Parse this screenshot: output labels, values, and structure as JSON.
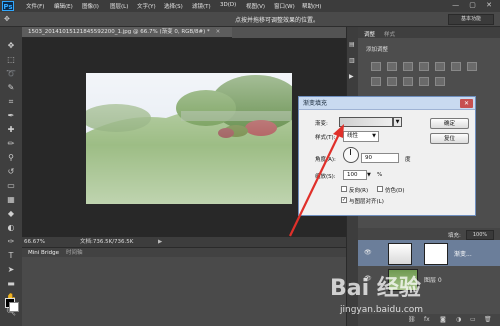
{
  "app": {
    "logo": "Ps"
  },
  "menu": [
    "文件(F)",
    "编辑(E)",
    "图像(I)",
    "图层(L)",
    "文字(Y)",
    "选择(S)",
    "滤镜(T)",
    "3D(D)",
    "视图(V)",
    "窗口(W)",
    "帮助(H)"
  ],
  "window_controls": "— ▢ ✕",
  "options_bar": {
    "hint": "点按并拖移可调整效果的位置。",
    "workspace": "基本功能"
  },
  "document": {
    "tab_title": "1503_20141015121845592200_1.jpg @ 66.7% (渐变 0, RGB/8#) *",
    "zoom": "66.67%",
    "doc_size": "文档:736.5K/736.5K"
  },
  "bottom_panel": {
    "tab1": "Mini Bridge",
    "tab2": "时间轴"
  },
  "right_panel": {
    "tab_adjust": "调整",
    "tab_styles": "样式",
    "add_adjustment": "添加调整",
    "fill_label": "填充:",
    "fill_value": "100%"
  },
  "layers": [
    {
      "name": "渐变...",
      "type": "gradient-fill"
    },
    {
      "name": "图层 0",
      "type": "image"
    }
  ],
  "dialog": {
    "title": "渐变填充",
    "gradient_label": "渐变:",
    "style_label": "样式(T):",
    "style_value": "线性",
    "angle_label": "角度(A):",
    "angle_value": "90",
    "angle_unit": "度",
    "scale_label": "缩放(S):",
    "scale_value": "100",
    "scale_unit": "%",
    "reverse_label": "反向(R)",
    "dither_label": "仿色(D)",
    "align_label": "与图层对齐(L)",
    "ok_button": "确定",
    "reset_button": "复位"
  },
  "watermark": {
    "brand": "Bai 经验",
    "url": "jingyan.baidu.com"
  },
  "colors": {
    "annotation_arrow": "#e0302a",
    "dialog_title_bg": "#c9daf0",
    "ps_blue": "#31a8ff"
  }
}
